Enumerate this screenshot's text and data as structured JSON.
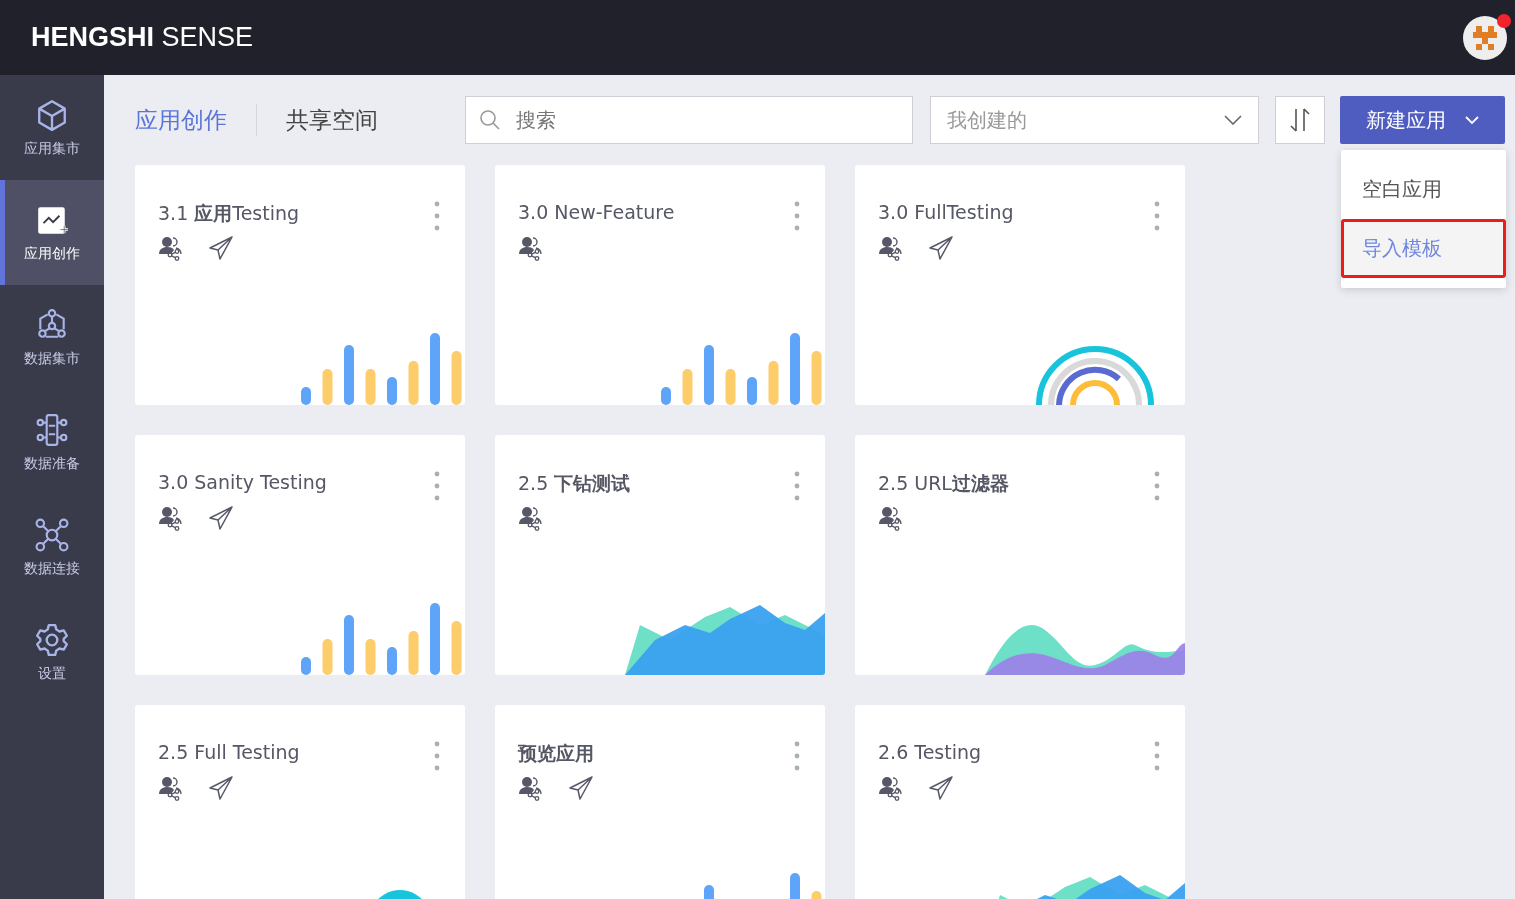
{
  "header": {
    "logo_bold": "HENGSHI",
    "logo_light": "SENSE",
    "notification": true
  },
  "sidebar": {
    "items": [
      {
        "label": "应用集市",
        "selected": false
      },
      {
        "label": "应用创作",
        "selected": true
      },
      {
        "label": "数据集市",
        "selected": false
      },
      {
        "label": "数据准备",
        "selected": false
      },
      {
        "label": "数据连接",
        "selected": false
      },
      {
        "label": "设置",
        "selected": false
      }
    ]
  },
  "tabs": [
    {
      "label": "应用创作",
      "selected": true
    },
    {
      "label": "共享空间",
      "selected": false
    }
  ],
  "search": {
    "placeholder": "搜索"
  },
  "filter": {
    "value": "我创建的"
  },
  "new_button": {
    "label": "新建应用",
    "expanded": true
  },
  "menu": [
    {
      "label": "空白应用",
      "highlighted": false
    },
    {
      "label": "导入模板",
      "highlighted": true
    }
  ],
  "cards": [
    {
      "title": "3.1 **应用**Testing",
      "bold": false,
      "published": true,
      "kind": "bars"
    },
    {
      "title": "3.0 New-Feature",
      "bold": false,
      "published": false,
      "kind": "bars"
    },
    {
      "title": "3.0 FullTesting",
      "bold": false,
      "published": true,
      "kind": "rings"
    },
    {
      "title": "3.0 Sanity Testing",
      "bold": false,
      "published": true,
      "kind": "bars"
    },
    {
      "title": "2.5 **下钻测试**",
      "bold": false,
      "published": false,
      "kind": "mountains"
    },
    {
      "title": "2.5 URL**过滤器**",
      "bold": false,
      "published": false,
      "kind": "waves"
    },
    {
      "title": "2.5 Full Testing",
      "bold": false,
      "published": true,
      "kind": "ring"
    },
    {
      "title": "预览应用",
      "bold": true,
      "published": true,
      "kind": "bars"
    },
    {
      "title": "2.6 Testing",
      "bold": false,
      "published": true,
      "kind": "mountains"
    }
  ]
}
